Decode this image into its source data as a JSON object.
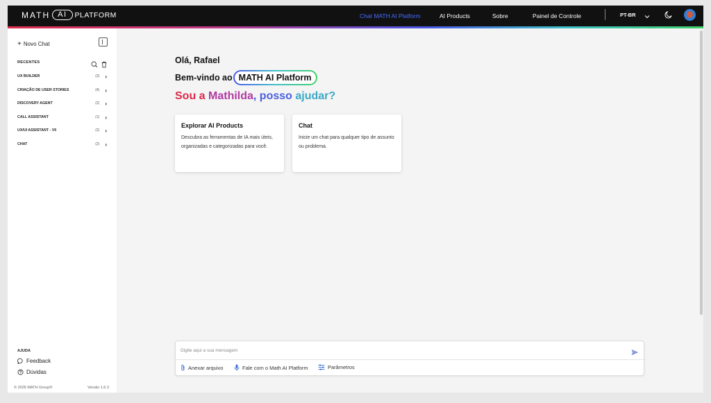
{
  "header": {
    "logo_math": "MATH",
    "logo_ai": "AI",
    "logo_platform": "PLATFORM",
    "nav": [
      {
        "label": "Chat MATH AI Platform",
        "active": true
      },
      {
        "label": "AI Products",
        "active": false
      },
      {
        "label": "Sobre",
        "active": false
      },
      {
        "label": "Painel de Controle",
        "active": false
      }
    ],
    "language": "PT-BR"
  },
  "sidebar": {
    "new_chat": "Novo Chat",
    "recent_label": "RECENTES",
    "items": [
      {
        "name": "UX BUILDER",
        "count": "(3)"
      },
      {
        "name": "CRIAÇÃO DE USER STORIES",
        "count": "(4)"
      },
      {
        "name": "DISCOVERY AGENT",
        "count": "(2)"
      },
      {
        "name": "CALL ASSISTANT",
        "count": "(1)"
      },
      {
        "name": "UX/UI ASSISTANT - V0",
        "count": "(2)"
      },
      {
        "name": "CHAT",
        "count": "(2)"
      }
    ],
    "help_label": "AJUDA",
    "feedback": "Feedback",
    "doubts": "Dúvidas",
    "copyright": "© 2026 MATH Group®",
    "version": "Versão 1.6.3"
  },
  "main": {
    "greeting": "Olá, Rafael",
    "welcome_prefix": "Bem-vindo ao",
    "welcome_brand": "MATH AI Platform",
    "tagline_1": "Sou a ",
    "tagline_2": "Mathilda",
    "tagline_3": ", posso ",
    "tagline_4": "ajudar?",
    "cards": [
      {
        "title": "Explorar AI Products",
        "text": "Descubra as ferramentas de IA mais úteis, organizadas e categorizadas para você."
      },
      {
        "title": "Chat",
        "text": "Inicie um chat para qualquer tipo de assunto ou problema."
      }
    ]
  },
  "composer": {
    "placeholder": "Digite aqui a sua mensagem",
    "attach": "Anexar arquivo",
    "voice": "Fale com o Math AI Platform",
    "params": "Parâmetros"
  },
  "colors": {
    "accent_nav": "#4a6cff",
    "tagline_red": "#d92a4a",
    "tagline_purple": "#b03aa0",
    "tagline_blue": "#4a60e0",
    "tagline_teal": "#3ba8c8"
  }
}
